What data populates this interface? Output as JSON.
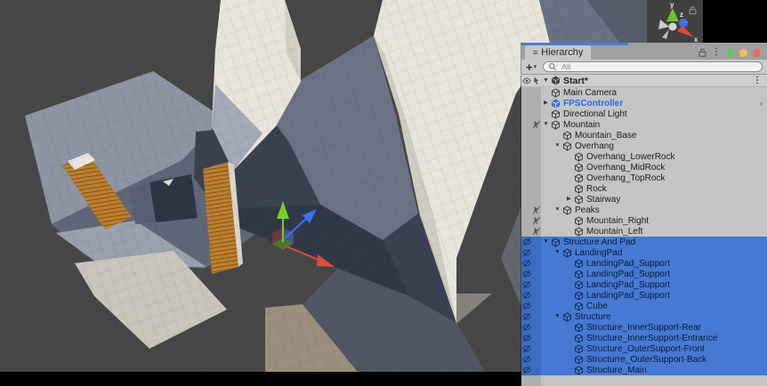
{
  "panel": {
    "tab_title": "Hierarchy",
    "traffic_lights": [
      "#63c856",
      "#f5bd4f",
      "#ee6a5f"
    ]
  },
  "toolbar": {
    "create_label": "+",
    "search_placeholder": "All"
  },
  "scene": {
    "name": "Start*"
  },
  "glyphs": {
    "list": "≡",
    "caret": "▾",
    "kebab": "⋮",
    "arrow_down": "▼",
    "arrow_right": "▶",
    "chevron": "›",
    "plus": "+"
  },
  "colors": {
    "selection": "#4579d4",
    "selection_gutter": "#3b6cc0",
    "prefab_text": "#2a6be0",
    "focus_bar": "#4a7fd1"
  },
  "scene_view": {
    "axis_labels": {
      "x": "x",
      "y": "y",
      "z": "z"
    },
    "gizmo_colors": {
      "x": "#e04b38",
      "y": "#78ce27",
      "z": "#3d6ff0"
    }
  },
  "hierarchy": {
    "rows": [
      {
        "label": "Main Camera",
        "depth": 0
      },
      {
        "label": "FPSController",
        "depth": 0,
        "arrow": "right",
        "prefab": true,
        "chevron": true
      },
      {
        "label": "Directional Light",
        "depth": 0
      },
      {
        "label": "Mountain",
        "depth": 0,
        "arrow": "down",
        "gutter": "pick-off"
      },
      {
        "label": "Mountain_Base",
        "depth": 1
      },
      {
        "label": "Overhang",
        "depth": 1,
        "arrow": "down"
      },
      {
        "label": "Overhang_LowerRock",
        "depth": 2
      },
      {
        "label": "Overhang_MidRock",
        "depth": 2
      },
      {
        "label": "Overhang_TopRock",
        "depth": 2
      },
      {
        "label": "Rock",
        "depth": 2
      },
      {
        "label": "Stairway",
        "depth": 2,
        "arrow": "right"
      },
      {
        "label": "Peaks",
        "depth": 1,
        "arrow": "down",
        "gutter": "pick-off"
      },
      {
        "label": "Mountain_Right",
        "depth": 2,
        "gutter": "pick-off"
      },
      {
        "label": "Mountain_Left",
        "depth": 2,
        "gutter": "pick-off"
      },
      {
        "label": "Structure And Pad",
        "depth": 0,
        "arrow": "down",
        "gutter": "eye-off",
        "selected": true
      },
      {
        "label": "LandingPad",
        "depth": 1,
        "arrow": "down",
        "gutter": "eye-off",
        "selected": true
      },
      {
        "label": "LandingPad_Support",
        "depth": 2,
        "gutter": "eye-off",
        "selected": true
      },
      {
        "label": "LandingPad_Support",
        "depth": 2,
        "gutter": "eye-off",
        "selected": true
      },
      {
        "label": "LandingPad_Support",
        "depth": 2,
        "gutter": "eye-off",
        "selected": true
      },
      {
        "label": "LandingPad_Support",
        "depth": 2,
        "gutter": "eye-off",
        "selected": true
      },
      {
        "label": "Cube",
        "depth": 2,
        "gutter": "eye-off",
        "selected": true
      },
      {
        "label": "Structure",
        "depth": 1,
        "arrow": "down",
        "gutter": "eye-off",
        "selected": true
      },
      {
        "label": "Structure_InnerSupport-Rear",
        "depth": 2,
        "gutter": "eye-off",
        "selected": true
      },
      {
        "label": "Structure_InnerSupport-Entrance",
        "depth": 2,
        "gutter": "eye-off",
        "selected": true
      },
      {
        "label": "Structure_OuterSupport-Front",
        "depth": 2,
        "gutter": "eye-off",
        "selected": true
      },
      {
        "label": "Structurre_OuterSupport-Back",
        "depth": 2,
        "gutter": "eye-off",
        "selected": true
      },
      {
        "label": "Structure_Main",
        "depth": 2,
        "gutter": "eye-off",
        "selected": true
      }
    ]
  }
}
